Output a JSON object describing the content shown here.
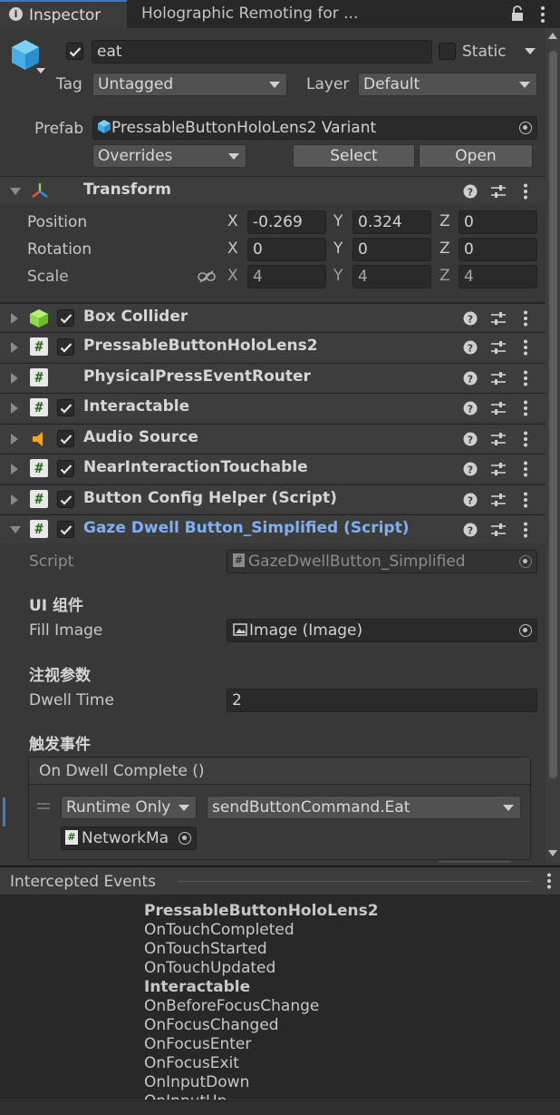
{
  "tabs": {
    "inspector": "Inspector",
    "holographic": "Holographic Remoting for ..."
  },
  "object": {
    "name": "eat",
    "static_label": "Static",
    "tag_label": "Tag",
    "tag_value": "Untagged",
    "layer_label": "Layer",
    "layer_value": "Default",
    "prefab_label": "Prefab",
    "prefab_value": "PressableButtonHoloLens2 Variant",
    "overrides": "Overrides",
    "select": "Select",
    "open": "Open"
  },
  "transform": {
    "title": "Transform",
    "position_label": "Position",
    "rotation_label": "Rotation",
    "scale_label": "Scale",
    "x": "X",
    "y": "Y",
    "z": "Z",
    "position": {
      "x": "-0.269",
      "y": "0.324",
      "z": "0"
    },
    "rotation": {
      "x": "0",
      "y": "0",
      "z": "0"
    },
    "scale": {
      "x": "4",
      "y": "4",
      "z": "4"
    }
  },
  "components": [
    {
      "title": "Box Collider"
    },
    {
      "title": "PressableButtonHoloLens2"
    },
    {
      "title": "PhysicalPressEventRouter"
    },
    {
      "title": "Interactable"
    },
    {
      "title": "Audio Source"
    },
    {
      "title": "NearInteractionTouchable"
    },
    {
      "title": "Button Config Helper (Script)"
    },
    {
      "title": "Gaze Dwell Button_Simplified (Script)"
    }
  ],
  "gaze": {
    "script_label": "Script",
    "script_value": "GazeDwellButton_Simplified",
    "ui_header": "UI 组件",
    "fill_image_label": "Fill Image",
    "fill_image_value": "Image (Image)",
    "gaze_header": "注视参数",
    "dwell_time_label": "Dwell Time",
    "dwell_time_value": "2",
    "event_header": "触发事件",
    "event_title": "On Dwell Complete ()",
    "runtime_value": "Runtime Only",
    "function_value": "sendButtonCommand.Eat",
    "object_value": "NetworkMa"
  },
  "intercepted": {
    "title": "Intercepted Events",
    "items": [
      {
        "text": "PressableButtonHoloLens2",
        "bold": true
      },
      {
        "text": "OnTouchCompleted"
      },
      {
        "text": "OnTouchStarted"
      },
      {
        "text": "OnTouchUpdated"
      },
      {
        "text": "Interactable",
        "bold": true
      },
      {
        "text": "OnBeforeFocusChange"
      },
      {
        "text": "OnFocusChanged"
      },
      {
        "text": "OnFocusEnter"
      },
      {
        "text": "OnFocusExit"
      },
      {
        "text": "OnInputDown"
      },
      {
        "text": "OnInputUp"
      }
    ]
  },
  "colors": {
    "accent_blue": "#7fb0f5",
    "background": "#383838",
    "header": "#3d3d3d"
  }
}
